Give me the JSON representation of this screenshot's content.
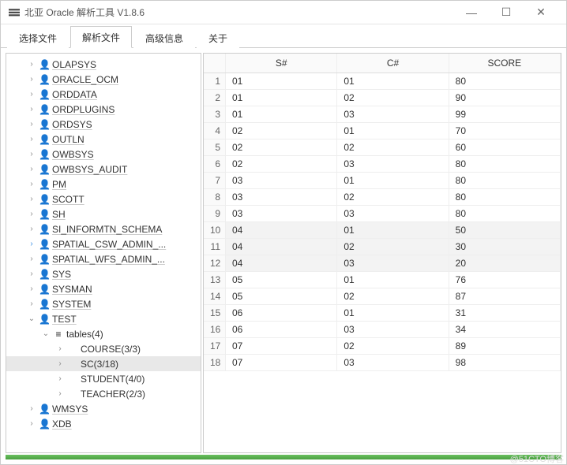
{
  "titlebar": {
    "title": "北亚 Oracle 解析工具  V1.8.6"
  },
  "winbuttons": {
    "min": "—",
    "max": "☐",
    "close": "✕"
  },
  "tabs": [
    {
      "label": "选择文件",
      "active": false
    },
    {
      "label": "解析文件",
      "active": true
    },
    {
      "label": "高级信息",
      "active": false
    },
    {
      "label": "关于",
      "active": false
    }
  ],
  "tree": [
    {
      "d": 1,
      "exp": "›",
      "icon": "user",
      "label": "OLAPSYS"
    },
    {
      "d": 1,
      "exp": "›",
      "icon": "user",
      "label": "ORACLE_OCM"
    },
    {
      "d": 1,
      "exp": "›",
      "icon": "user",
      "label": "ORDDATA"
    },
    {
      "d": 1,
      "exp": "›",
      "icon": "user",
      "label": "ORDPLUGINS"
    },
    {
      "d": 1,
      "exp": "›",
      "icon": "user",
      "label": "ORDSYS"
    },
    {
      "d": 1,
      "exp": "›",
      "icon": "user",
      "label": "OUTLN"
    },
    {
      "d": 1,
      "exp": "›",
      "icon": "user",
      "label": "OWBSYS"
    },
    {
      "d": 1,
      "exp": "›",
      "icon": "user",
      "label": "OWBSYS_AUDIT"
    },
    {
      "d": 1,
      "exp": "›",
      "icon": "user",
      "label": "PM"
    },
    {
      "d": 1,
      "exp": "›",
      "icon": "user",
      "label": "SCOTT"
    },
    {
      "d": 1,
      "exp": "›",
      "icon": "user",
      "label": "SH"
    },
    {
      "d": 1,
      "exp": "›",
      "icon": "user",
      "label": "SI_INFORMTN_SCHEMA"
    },
    {
      "d": 1,
      "exp": "›",
      "icon": "user",
      "label": "SPATIAL_CSW_ADMIN_...",
      "blue": true
    },
    {
      "d": 1,
      "exp": "›",
      "icon": "user",
      "label": "SPATIAL_WFS_ADMIN_..."
    },
    {
      "d": 1,
      "exp": "›",
      "icon": "user",
      "label": "SYS"
    },
    {
      "d": 1,
      "exp": "›",
      "icon": "user",
      "label": "SYSMAN"
    },
    {
      "d": 1,
      "exp": "›",
      "icon": "user",
      "label": "SYSTEM"
    },
    {
      "d": 1,
      "exp": "⌄",
      "icon": "user",
      "label": "TEST"
    },
    {
      "d": 2,
      "exp": "⌄",
      "icon": "list",
      "label": "tables(4)",
      "nound": true
    },
    {
      "d": 3,
      "exp": "›",
      "icon": "",
      "label": "COURSE(3/3)",
      "nound": true
    },
    {
      "d": 3,
      "exp": "›",
      "icon": "",
      "label": "SC(3/18)",
      "nound": true,
      "sel": true
    },
    {
      "d": 3,
      "exp": "›",
      "icon": "",
      "label": "STUDENT(4/0)",
      "nound": true
    },
    {
      "d": 3,
      "exp": "›",
      "icon": "",
      "label": "TEACHER(2/3)",
      "nound": true
    },
    {
      "d": 1,
      "exp": "›",
      "icon": "user",
      "label": "WMSYS"
    },
    {
      "d": 1,
      "exp": "›",
      "icon": "user",
      "label": "XDB"
    }
  ],
  "grid": {
    "columns": [
      "S#",
      "C#",
      "SCORE"
    ],
    "rows": [
      [
        "01",
        "01",
        "80"
      ],
      [
        "01",
        "02",
        "90"
      ],
      [
        "01",
        "03",
        "99"
      ],
      [
        "02",
        "01",
        "70"
      ],
      [
        "02",
        "02",
        "60"
      ],
      [
        "02",
        "03",
        "80"
      ],
      [
        "03",
        "01",
        "80"
      ],
      [
        "03",
        "02",
        "80"
      ],
      [
        "03",
        "03",
        "80"
      ],
      [
        "04",
        "01",
        "50"
      ],
      [
        "04",
        "02",
        "30"
      ],
      [
        "04",
        "03",
        "20"
      ],
      [
        "05",
        "01",
        "76"
      ],
      [
        "05",
        "02",
        "87"
      ],
      [
        "06",
        "01",
        "31"
      ],
      [
        "06",
        "03",
        "34"
      ],
      [
        "07",
        "02",
        "89"
      ],
      [
        "07",
        "03",
        "98"
      ]
    ]
  },
  "watermark": "@51CTO博客"
}
